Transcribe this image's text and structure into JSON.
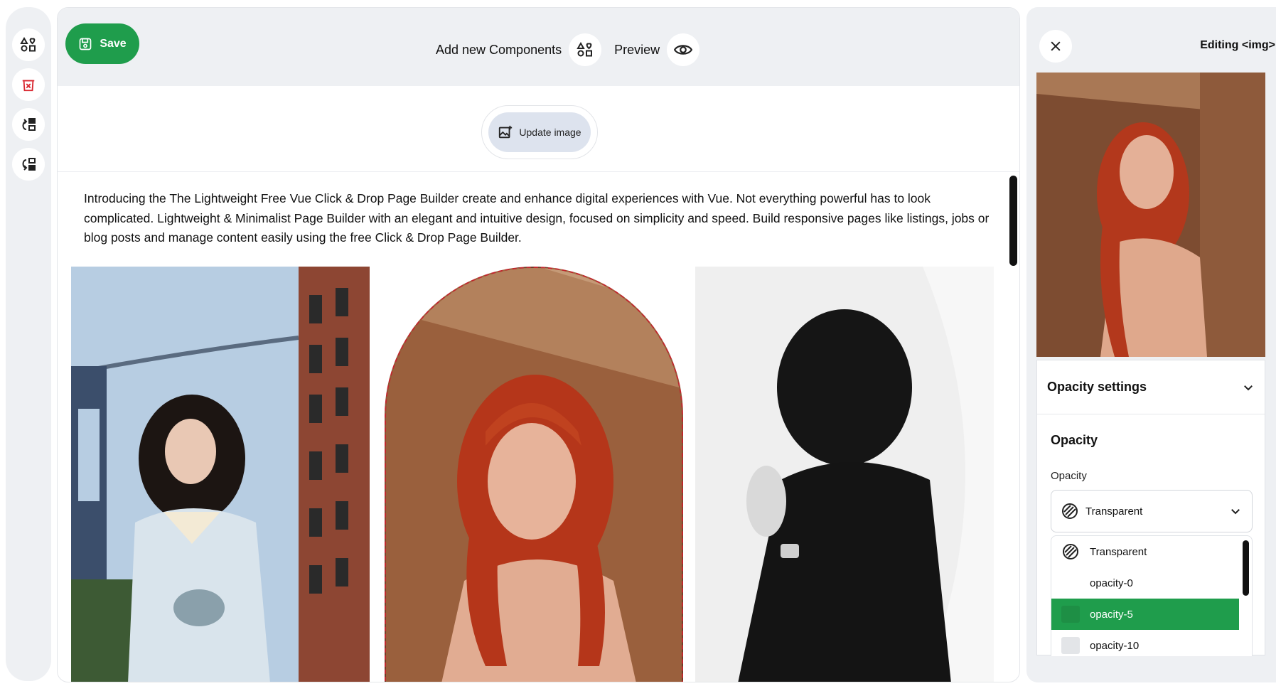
{
  "left_toolbar": {
    "items": [
      {
        "icon": "components-icon"
      },
      {
        "icon": "delete-icon",
        "color": "#d9262f"
      },
      {
        "icon": "move-up-icon"
      },
      {
        "icon": "move-down-icon"
      }
    ]
  },
  "header": {
    "save_label": "Save",
    "add_components_label": "Add new Components",
    "preview_label": "Preview"
  },
  "canvas": {
    "update_image_label": "Update image",
    "intro_text": "Introducing the The Lightweight Free Vue Click & Drop Page Builder create and enhance digital experiences with Vue. Not everything powerful has to look complicated. Lightweight & Minimalist Page Builder with an elegant and intuitive design, focused on simplicity and speed. Build responsive pages like listings, jobs or blog posts and manage content easily using the free Click & Drop Page Builder."
  },
  "editor_panel": {
    "title": "Editing <img>",
    "settings_title": "Opacity settings",
    "section_title": "Opacity",
    "field_label": "Opacity",
    "selected_value": "Transparent",
    "options": [
      {
        "label": "Transparent",
        "icon": "transparent-icon"
      },
      {
        "label": "opacity-0"
      },
      {
        "label": "opacity-5",
        "selected": true
      },
      {
        "label": "opacity-10"
      }
    ]
  },
  "colors": {
    "accent": "#1f9d4c",
    "danger": "#d9262f",
    "panel_bg": "#eef0f3"
  }
}
